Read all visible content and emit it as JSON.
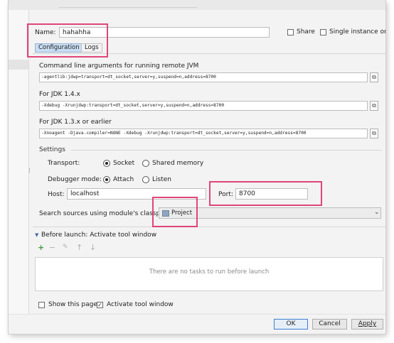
{
  "name": {
    "label": "Name:",
    "value": "hahahha"
  },
  "share_label": "Share",
  "single_instance_label": "Single instance only",
  "tabs": [
    {
      "label": "Configuration"
    },
    {
      "label": "Logs"
    }
  ],
  "sections": {
    "jvm": {
      "label": "Command line arguments for running remote JVM",
      "value": "-agentlib:jdwp=transport=dt_socket,server=y,suspend=n,address=8700"
    },
    "jdk14": {
      "label": "For JDK 1.4.x",
      "value": "-Xdebug -Xrunjdwp:transport=dt_socket,server=y,suspend=n,address=8700"
    },
    "jdk13": {
      "label": "For JDK 1.3.x or earlier",
      "value": "-Xnoagent -Djava.compiler=NONE -Xdebug -Xrunjdwp:transport=dt_socket,server=y,suspend=n,address=8700"
    }
  },
  "settings": {
    "title": "Settings",
    "transport": {
      "label": "Transport:",
      "options": [
        "Socket",
        "Shared memory"
      ],
      "selected": "Socket"
    },
    "debugger_mode": {
      "label": "Debugger mode:",
      "options": [
        "Attach",
        "Listen"
      ],
      "selected": "Attach"
    },
    "host": {
      "label": "Host:",
      "value": "localhost"
    },
    "port": {
      "label": "Port:",
      "value": "8700"
    },
    "search_sources": {
      "label": "Search sources using module's classpath:",
      "value": "Project"
    }
  },
  "before_launch": {
    "title": "Before launch: Activate tool window",
    "empty_text": "There are no tasks to run before launch",
    "toolbar": [
      {
        "symbol": "+",
        "icon": "plus-icon"
      },
      {
        "symbol": "−",
        "icon": "minus-icon"
      },
      {
        "symbol": "✎",
        "icon": "edit-icon"
      },
      {
        "symbol": "↑",
        "icon": "arrow-up-icon"
      },
      {
        "symbol": "↓",
        "icon": "arrow-down-icon"
      }
    ]
  },
  "show_this_page": {
    "label": "Show this page",
    "checked": false
  },
  "activate_tool_window": {
    "label": "Activate tool window",
    "checked": true
  },
  "buttons": {
    "ok": "OK",
    "cancel": "Cancel",
    "apply": "Apply"
  },
  "colors": {
    "highlight_box": "#e0457b",
    "active_tab": "#c9ddf2",
    "plus_green": "#3c9c3c"
  }
}
